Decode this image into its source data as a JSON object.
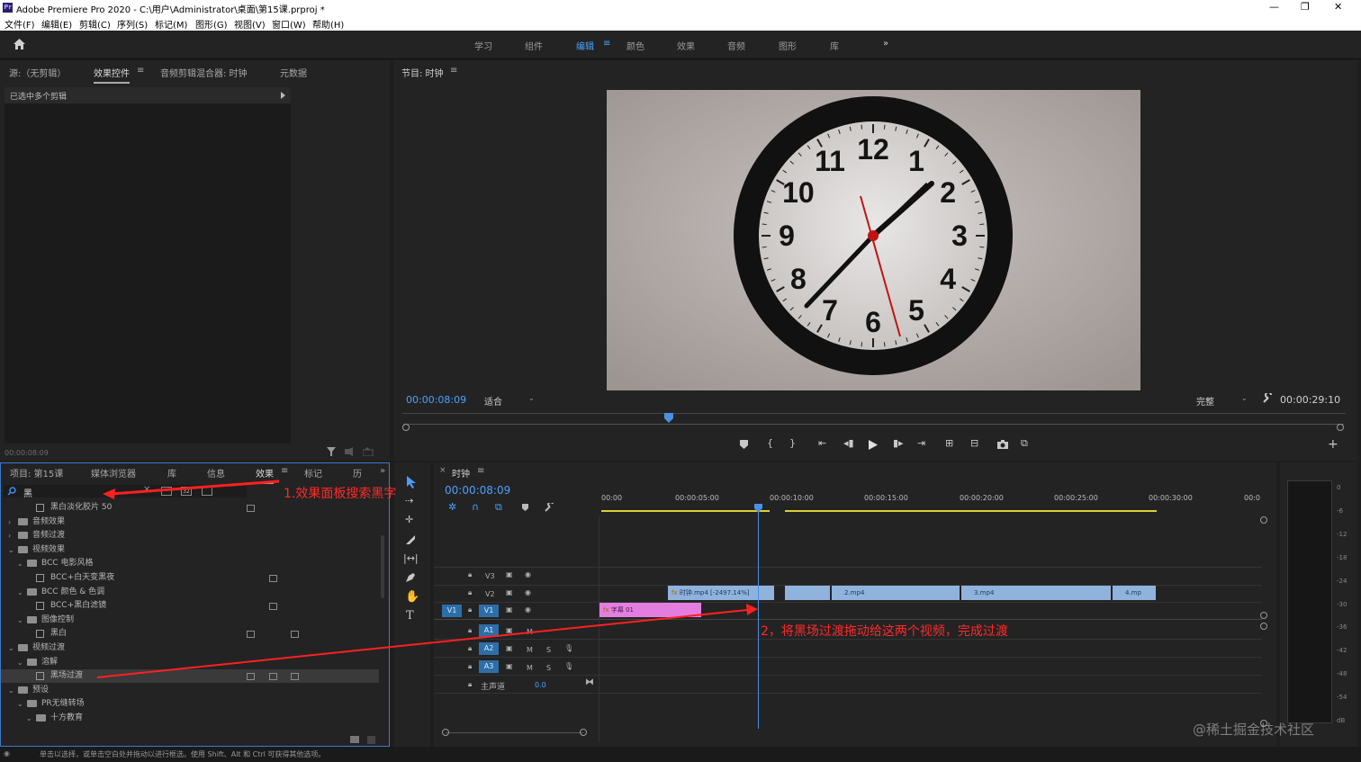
{
  "app": {
    "title": "Adobe Premiere Pro 2020 - C:\\用户\\Administrator\\桌面\\第15课.prproj *",
    "logo": "Pr",
    "minimize": "—",
    "restore": "❐",
    "close": "✕"
  },
  "menu": [
    "文件(F)",
    "编辑(E)",
    "剪辑(C)",
    "序列(S)",
    "标记(M)",
    "图形(G)",
    "视图(V)",
    "窗口(W)",
    "帮助(H)"
  ],
  "workspaces": [
    "学习",
    "组件",
    "编辑",
    "颜色",
    "效果",
    "音频",
    "图形",
    "库"
  ],
  "workspace_more": "»",
  "workspace_menu_icon": "≡",
  "source_panel": {
    "tabs": [
      "源:（无剪辑）",
      "效果控件",
      "音频剪辑混合器: 时钟",
      "元数据"
    ],
    "menu_icon": "≡",
    "selection_text": "已选中多个剪辑",
    "timecode": "00:00:08:09"
  },
  "program": {
    "title": "节目: 时钟",
    "menu_icon": "≡",
    "timecode": "00:00:08:09",
    "fit": "适合",
    "quality": "完整",
    "duration": "00:00:29:10"
  },
  "clock_numbers": [
    "12",
    "1",
    "2",
    "3",
    "4",
    "5",
    "6",
    "7",
    "8",
    "9",
    "10",
    "11"
  ],
  "project_panel": {
    "tabs": [
      "项目: 第15课",
      "媒体浏览器",
      "库",
      "信息",
      "效果",
      "标记",
      "历"
    ],
    "more": "»",
    "search_value": "黑",
    "tree": [
      {
        "label": "黑白淡化胶片 50",
        "kind": "fx",
        "indent": 3
      },
      {
        "label": "音频效果",
        "kind": "folder",
        "indent": 1
      },
      {
        "label": "音频过渡",
        "kind": "folder",
        "indent": 1
      },
      {
        "label": "视频效果",
        "kind": "folder",
        "indent": 1
      },
      {
        "label": "BCC 电影风格",
        "kind": "folder",
        "indent": 2
      },
      {
        "label": "BCC+白天变黑夜",
        "kind": "fx",
        "indent": 3
      },
      {
        "label": "BCC 颜色 & 色调",
        "kind": "folder",
        "indent": 2
      },
      {
        "label": "BCC+黑白滤镜",
        "kind": "fx",
        "indent": 3
      },
      {
        "label": "图像控制",
        "kind": "folder",
        "indent": 2
      },
      {
        "label": "黑白",
        "kind": "fx",
        "indent": 3
      },
      {
        "label": "视频过渡",
        "kind": "folder",
        "indent": 1
      },
      {
        "label": "溶解",
        "kind": "folder",
        "indent": 2
      },
      {
        "label": "黑场过渡",
        "kind": "fx",
        "indent": 3
      },
      {
        "label": "预设",
        "kind": "folder",
        "indent": 1
      },
      {
        "label": "PR无缝转场",
        "kind": "folder",
        "indent": 2
      },
      {
        "label": "十方教育",
        "kind": "folder",
        "indent": 3
      }
    ]
  },
  "annotations": {
    "step1": "1.效果面板搜索黑字",
    "step2": "2，将黑场过渡拖动给这两个视频，完成过渡"
  },
  "timeline": {
    "tab": "时钟",
    "menu_icon": "≡",
    "timecode": "00:00:08:09",
    "ruler": [
      "00:00",
      "00:00:05:00",
      "00:00:10:00",
      "00:00:15:00",
      "00:00:20:00",
      "00:00:25:00",
      "00:00:30:00",
      "00:0"
    ],
    "tracks": [
      "V3",
      "V2",
      "V1",
      "A1",
      "A2",
      "A3"
    ],
    "source_v1": "V1",
    "master": "主声道",
    "master_value": "0.0",
    "m_label": "M",
    "s_label": "S",
    "clips": {
      "clock": "时钟.mp4 [-2497.14%]",
      "c2": "2.mp4",
      "c3": "3.mp4",
      "c4": "4.mp",
      "title": "字幕 01"
    }
  },
  "meter": {
    "labels": [
      "0",
      "-6",
      "-12",
      "-18",
      "-24",
      "-30",
      "-36",
      "-42",
      "-48",
      "-54",
      "dB"
    ]
  },
  "status": "单击以选择，或单击空白处并拖动以进行框选。使用 Shift、Alt 和 Ctrl 可获得其他选项。",
  "watermark": "@稀土掘金技术社区"
}
